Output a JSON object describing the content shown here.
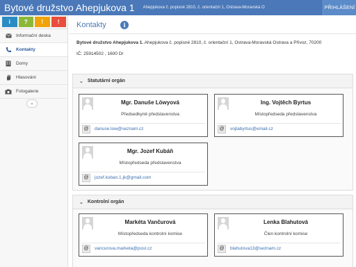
{
  "header": {
    "brand": "Bytové družstvo Ahepjukova 1",
    "address": "Ahepjukova č. popisné 2810, č. orientační 1, Ostrava-Moravská O",
    "login_label": "PŘIHLÁŠENÍ",
    "color": "#4a78b8"
  },
  "quick_buttons": [
    {
      "icon": "info-icon",
      "glyph": "i",
      "color": "#2b8cc4"
    },
    {
      "icon": "question-icon",
      "glyph": "?",
      "color": "#8cb83a"
    },
    {
      "icon": "warning-icon",
      "glyph": "!",
      "color": "#f0a30a"
    },
    {
      "icon": "alert-icon",
      "glyph": "!",
      "color": "#e94e3c"
    }
  ],
  "sidebar": {
    "items": [
      {
        "label": "Informační deska",
        "icon": "envelope-icon"
      },
      {
        "label": "Kontakty",
        "icon": "phone-icon",
        "active": true
      },
      {
        "label": "Domy",
        "icon": "building-icon"
      },
      {
        "label": "Hlasování",
        "icon": "hand-icon"
      },
      {
        "label": "Fotogalerie",
        "icon": "camera-icon"
      }
    ],
    "collapse_glyph": "«"
  },
  "main": {
    "title": "Kontakty",
    "org_name": "Bytové družstvo Ahepjukova 1.",
    "org_address": " Ahepjukova č. popisné 2810, č. orientační 1, Ostrava-Moravská Ostrava a Přívoz, 70200",
    "ic_line": "IČ: 25914502 , 1600 Dr"
  },
  "sections": [
    {
      "title": "Statutární orgán",
      "contacts": [
        {
          "name": "Mgr. Danuše Löwyová",
          "role": "Předsedkyně představenstva",
          "email": "danuse.low@seznam.cz"
        },
        {
          "name": "Ing. Vojtěch Byrtus",
          "role": "Místopředseda představenstva",
          "email": "vojtabyrtus@email.cz"
        },
        {
          "name": "Mgr. Jozef Kubáň",
          "role": "Místopředseda představenstva",
          "email": "jozef.kuban.1.jk@gmail.com"
        }
      ]
    },
    {
      "title": "Kontrolní orgán",
      "contacts": [
        {
          "name": "Markéta Vančurová",
          "role": "Místopředseda kontrolní komise",
          "email": "vancurova.marketa@post.cz"
        },
        {
          "name": "Lenka Blahutová",
          "role": "Člen kontrolní komise",
          "email": "blahutova13@seznam.cz"
        }
      ]
    }
  ]
}
